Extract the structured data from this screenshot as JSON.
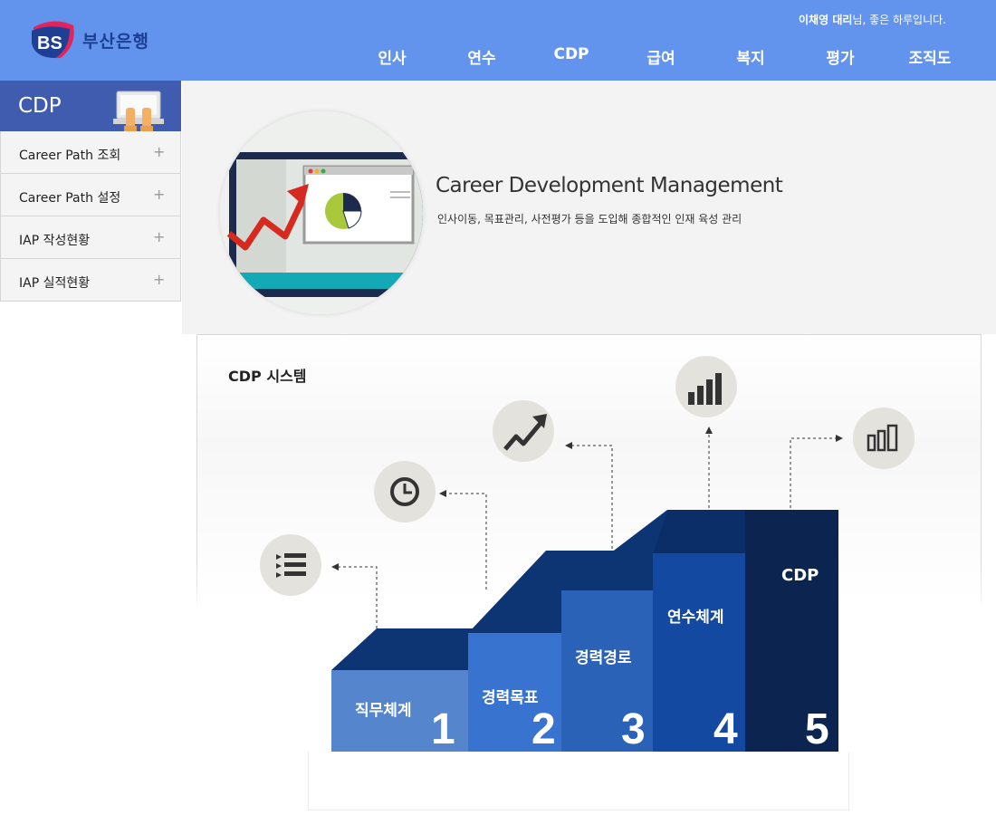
{
  "brand": {
    "logo_mark": "BS",
    "name": "부산은행"
  },
  "header": {
    "user_name": "이채영 대리",
    "greeting_suffix": "님, 좋은 하루입니다.",
    "nav": [
      "인사",
      "연수",
      "CDP",
      "급여",
      "복지",
      "평가",
      "조직도"
    ]
  },
  "sidebar": {
    "title": "CDP",
    "items": [
      {
        "label": "Career Path 조회",
        "icon": "+"
      },
      {
        "label": "Career Path 설정",
        "icon": "+"
      },
      {
        "label": "IAP 작성현황",
        "icon": "+"
      },
      {
        "label": "IAP 실적현황",
        "icon": "+"
      }
    ]
  },
  "hero": {
    "title": "Career Development Management",
    "subtitle": "인사이동, 목표관리, 사전평가 등을 도입해 종합적인 인재 육성 관리"
  },
  "system": {
    "title": "CDP 시스템",
    "steps": [
      {
        "label": "직무체계",
        "number": "1",
        "icon": "list-icon"
      },
      {
        "label": "경력목표",
        "number": "2",
        "icon": "clock-icon"
      },
      {
        "label": "경력경로",
        "number": "3",
        "icon": "trend-arrow-icon"
      },
      {
        "label": "연수체계",
        "number": "4",
        "icon": "bar-chart-icon"
      },
      {
        "label": "CDP",
        "number": "5",
        "icon": "bar-blocks-icon"
      }
    ]
  },
  "colors": {
    "header_bg": "#6294ee",
    "sidebar_head": "#3f5cae",
    "step1": "#5585cd",
    "step2": "#3874cf",
    "step3": "#2a62b8",
    "step4": "#1449a2",
    "step5": "#0c2550",
    "stair_top": "#0d3473",
    "icon_circle": "#e4e2dc"
  }
}
